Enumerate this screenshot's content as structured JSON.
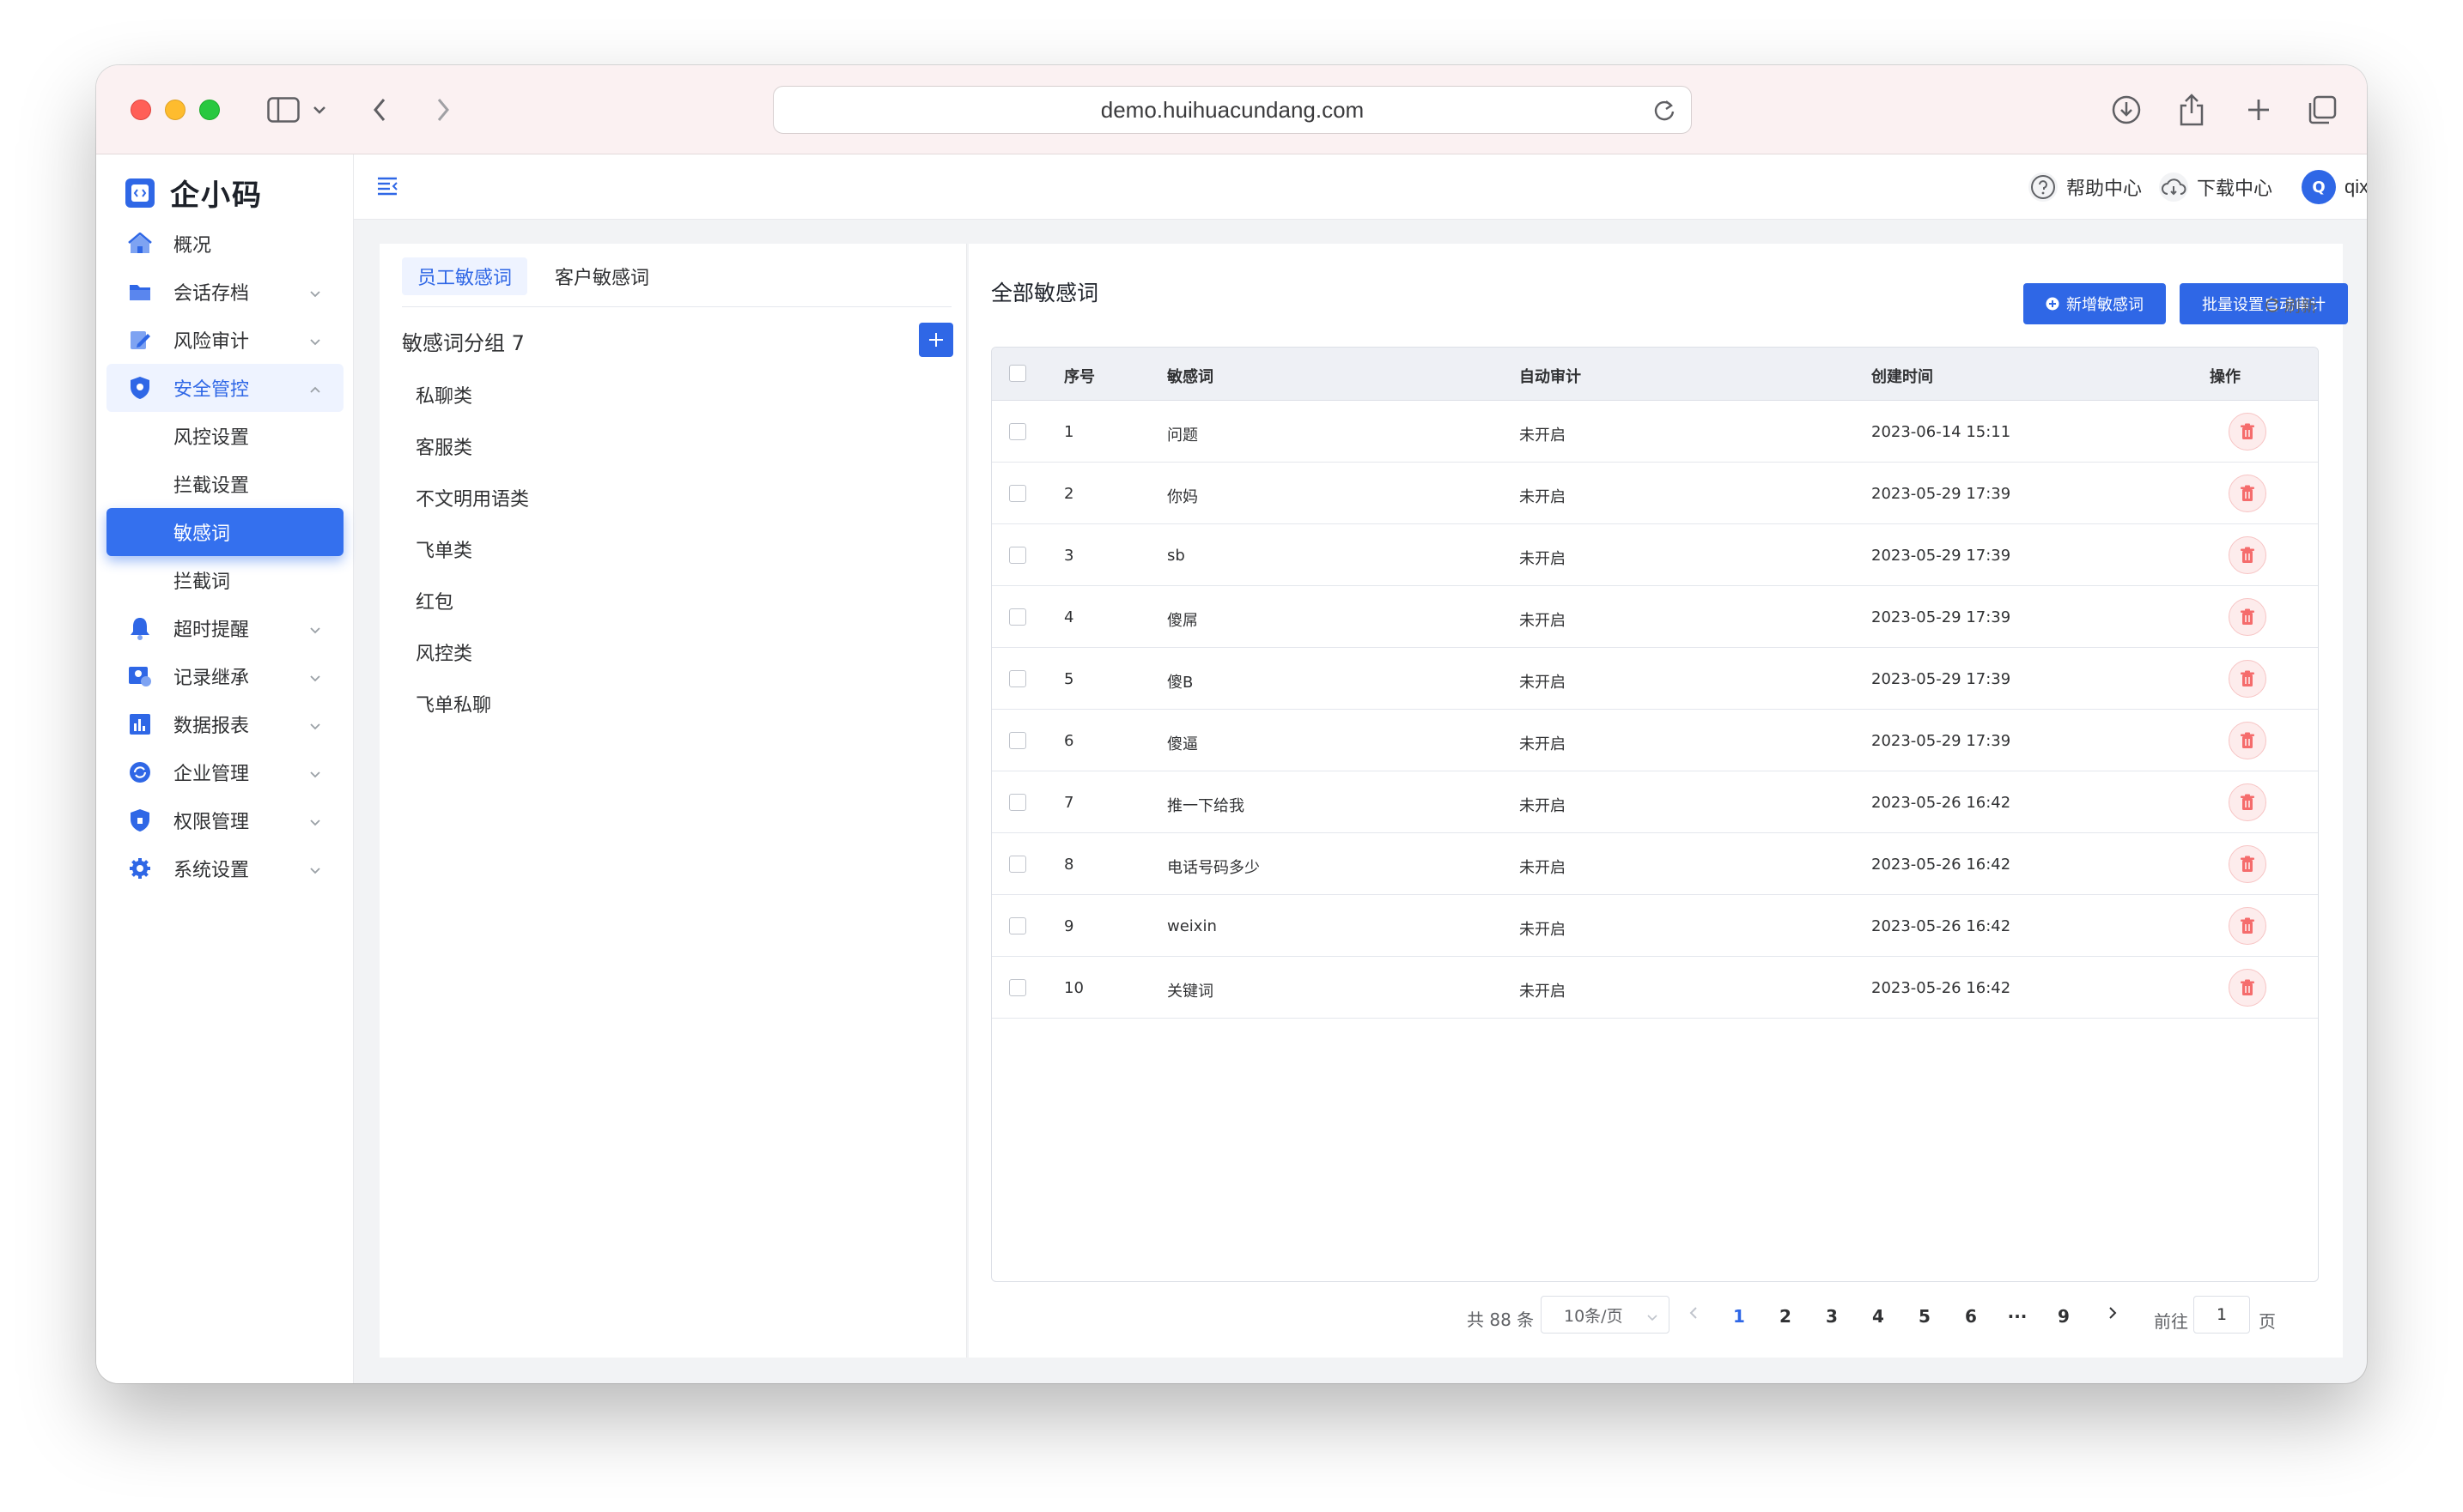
{
  "browser": {
    "url": "demo.huihuacundang.com"
  },
  "app": {
    "logo_text": "企小码"
  },
  "sidebar": {
    "items": [
      {
        "label": "概况"
      },
      {
        "label": "会话存档"
      },
      {
        "label": "风险审计"
      },
      {
        "label": "安全管控"
      },
      {
        "label": "风控设置"
      },
      {
        "label": "拦截设置"
      },
      {
        "label": "敏感词"
      },
      {
        "label": "拦截词"
      },
      {
        "label": "超时提醒"
      },
      {
        "label": "记录继承"
      },
      {
        "label": "数据报表"
      },
      {
        "label": "企业管理"
      },
      {
        "label": "权限管理"
      },
      {
        "label": "系统设置"
      }
    ]
  },
  "header": {
    "help_label": "帮助中心",
    "download_label": "下载中心",
    "avatar_letter": "Q",
    "username": "qixiaoma"
  },
  "groups": {
    "tabs": [
      "员工敏感词",
      "客户敏感词"
    ],
    "title": "敏感词分组 7",
    "items": [
      "私聊类",
      "客服类",
      "不文明用语类",
      "飞单类",
      "红包",
      "风控类",
      "飞单私聊"
    ]
  },
  "main": {
    "title": "全部敏感词",
    "add_label": "新增敏感词",
    "batch_label": "批量设置自动审计",
    "refresh_label": "刷新",
    "columns": [
      "序号",
      "敏感词",
      "自动审计",
      "创建时间",
      "操作"
    ],
    "rows": [
      {
        "no": "1",
        "word": "问题",
        "audit": "未开启",
        "time": "2023-06-14 15:11"
      },
      {
        "no": "2",
        "word": "你妈",
        "audit": "未开启",
        "time": "2023-05-29 17:39"
      },
      {
        "no": "3",
        "word": "sb",
        "audit": "未开启",
        "time": "2023-05-29 17:39"
      },
      {
        "no": "4",
        "word": "傻屌",
        "audit": "未开启",
        "time": "2023-05-29 17:39"
      },
      {
        "no": "5",
        "word": "傻B",
        "audit": "未开启",
        "time": "2023-05-29 17:39"
      },
      {
        "no": "6",
        "word": "傻逼",
        "audit": "未开启",
        "time": "2023-05-29 17:39"
      },
      {
        "no": "7",
        "word": "推一下给我",
        "audit": "未开启",
        "time": "2023-05-26 16:42"
      },
      {
        "no": "8",
        "word": "电话号码多少",
        "audit": "未开启",
        "time": "2023-05-26 16:42"
      },
      {
        "no": "9",
        "word": "weixin",
        "audit": "未开启",
        "time": "2023-05-26 16:42"
      },
      {
        "no": "10",
        "word": "关键词",
        "audit": "未开启",
        "time": "2023-05-26 16:42"
      }
    ]
  },
  "pagination": {
    "total": "共 88 条",
    "page_size": "10条/页",
    "pages": [
      "1",
      "2",
      "3",
      "4",
      "5",
      "6",
      "···",
      "9"
    ],
    "goto_label": "前往",
    "goto_value": "1",
    "page_suffix": "页"
  },
  "colors": {
    "primary": "#2f67e6",
    "danger": "#f56c6c"
  }
}
